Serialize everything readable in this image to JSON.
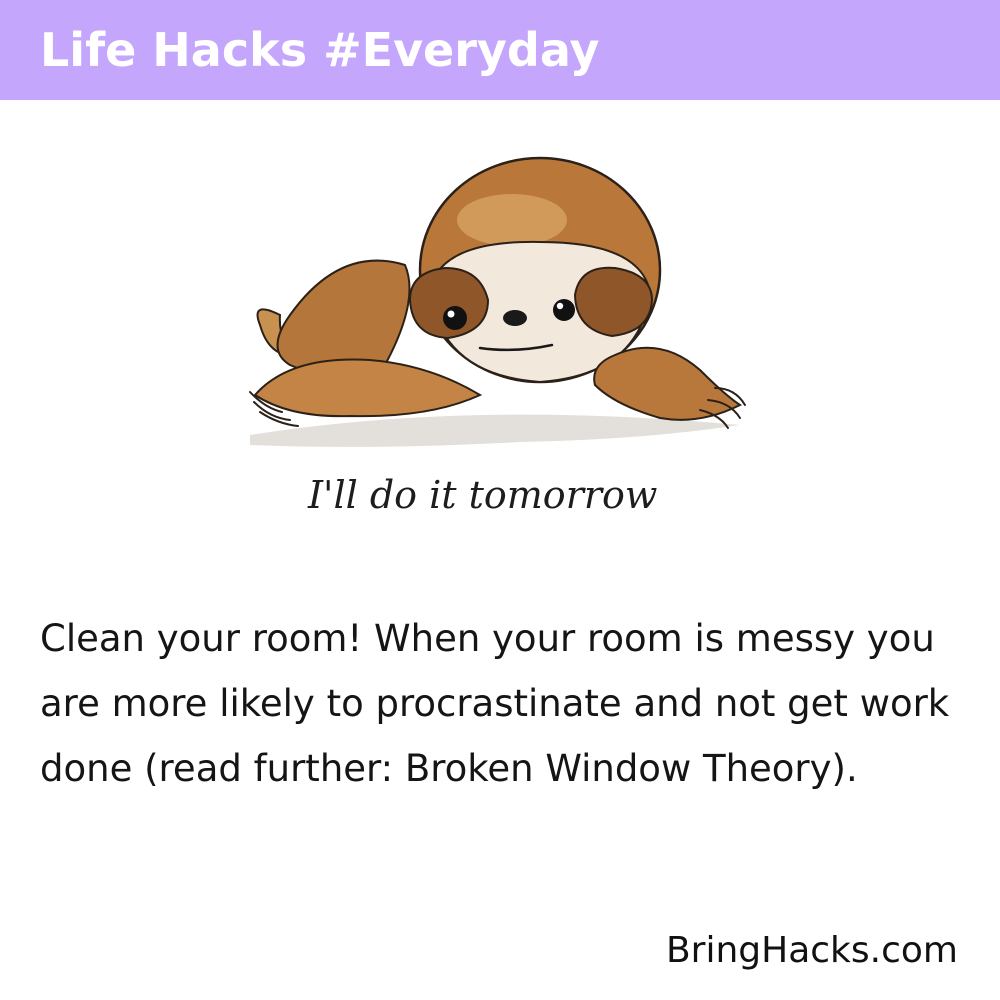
{
  "header": {
    "title": "Life Hacks #Everyday",
    "background_color": "#c4a6fd"
  },
  "illustration": {
    "subject": "sloth",
    "handwritten_text": "I'll do it tomorrow"
  },
  "tip": {
    "text": "Clean your room! When your room is messy you are more likely to procrastinate and not get work done (read further: Broken Window Theory)."
  },
  "footer": {
    "brand": "BringHacks.com"
  }
}
